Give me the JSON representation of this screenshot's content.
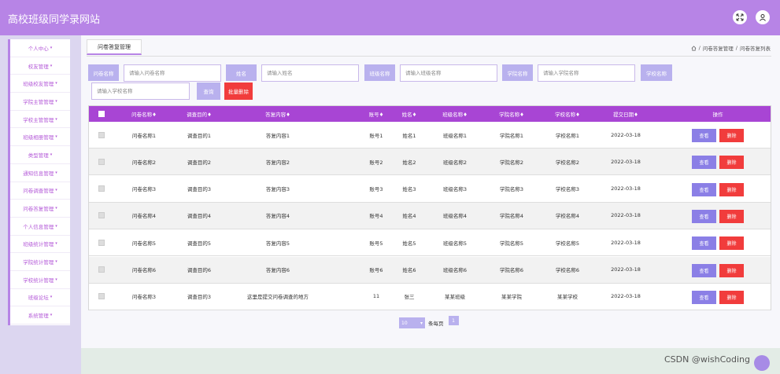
{
  "app": {
    "title": "高校班级同学录网站"
  },
  "colors": {
    "accent": "#b784e6",
    "table_header": "#a845d4",
    "danger": "#f13c3c",
    "label_bg": "#b9b1ee"
  },
  "header": {
    "icons": [
      "fullscreen-icon",
      "user-icon"
    ]
  },
  "sidebar": {
    "items": [
      {
        "label": "个人中心"
      },
      {
        "label": "校友管理"
      },
      {
        "label": "班级校友管理"
      },
      {
        "label": "学院主管管理"
      },
      {
        "label": "学校主管管理"
      },
      {
        "label": "班级相册管理"
      },
      {
        "label": "类型管理"
      },
      {
        "label": "通知信息管理"
      },
      {
        "label": "问卷调查管理"
      },
      {
        "label": "问卷答复管理"
      },
      {
        "label": "个人信息管理"
      },
      {
        "label": "班级统计管理"
      },
      {
        "label": "学院统计管理"
      },
      {
        "label": "学校统计管理"
      },
      {
        "label": "班级论坛"
      },
      {
        "label": "系统管理"
      }
    ]
  },
  "tab": {
    "label": "问卷答复管理"
  },
  "breadcrumb": {
    "parent": "问卷答复管理",
    "sep": "/",
    "current": "问卷答复列表"
  },
  "search": {
    "questionnaire": {
      "label": "问卷名称",
      "placeholder": "请输入问卷名称"
    },
    "name": {
      "label": "姓名",
      "placeholder": "请输入姓名"
    },
    "class": {
      "label": "班级名称",
      "placeholder": "请输入班级名称"
    },
    "college": {
      "label": "学院名称",
      "placeholder": "请输入学院名称"
    },
    "school": {
      "label": "学校名称",
      "placeholder": "请输入学校名称"
    },
    "search_button": "查询",
    "batch_delete_button": "批量删除"
  },
  "table": {
    "headers": [
      "问卷名称♦",
      "调查目的♦",
      "答复内容♦",
      "账号♦",
      "姓名♦",
      "班级名称♦",
      "学院名称♦",
      "学校名称♦",
      "提交日期♦",
      "操作"
    ],
    "view_label": "查看",
    "delete_label": "删除",
    "rows": [
      [
        "问卷名称1",
        "调查目的1",
        "答复内容1",
        "账号1",
        "姓名1",
        "班级名称1",
        "学院名称1",
        "学校名称1",
        "2022-03-18"
      ],
      [
        "问卷名称2",
        "调查目的2",
        "答复内容2",
        "账号2",
        "姓名2",
        "班级名称2",
        "学院名称2",
        "学校名称2",
        "2022-03-18"
      ],
      [
        "问卷名称3",
        "调查目的3",
        "答复内容3",
        "账号3",
        "姓名3",
        "班级名称3",
        "学院名称3",
        "学校名称3",
        "2022-03-18"
      ],
      [
        "问卷名称4",
        "调查目的4",
        "答复内容4",
        "账号4",
        "姓名4",
        "班级名称4",
        "学院名称4",
        "学校名称4",
        "2022-03-18"
      ],
      [
        "问卷名称5",
        "调查目的5",
        "答复内容5",
        "账号5",
        "姓名5",
        "班级名称5",
        "学院名称5",
        "学校名称5",
        "2022-03-18"
      ],
      [
        "问卷名称6",
        "调查目的6",
        "答复内容6",
        "账号6",
        "姓名6",
        "班级名称6",
        "学院名称6",
        "学校名称6",
        "2022-03-18"
      ],
      [
        "问卷名称3",
        "调查目的3",
        "这里是提交问卷调查的地方",
        "11",
        "张三",
        "某某班级",
        "某某学院",
        "某某学校",
        "2022-03-18"
      ]
    ]
  },
  "pagination": {
    "page_size": "10",
    "per_page_label": "条每页",
    "current_page": "1"
  },
  "watermark": "CSDN @wishCoding"
}
